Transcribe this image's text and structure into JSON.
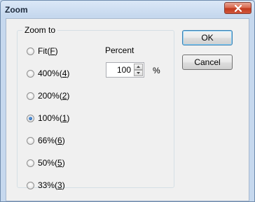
{
  "window": {
    "title": "Zoom"
  },
  "group": {
    "label": "Zoom to"
  },
  "options": [
    {
      "text": "Fit(",
      "key": "F",
      "end": ")",
      "checked": false
    },
    {
      "text": "400%(",
      "key": "4",
      "end": ")",
      "checked": false
    },
    {
      "text": "200%(",
      "key": "2",
      "end": ")",
      "checked": false
    },
    {
      "text": "100%(",
      "key": "1",
      "end": ")",
      "checked": true
    },
    {
      "text": "66%(",
      "key": "6",
      "end": ")",
      "checked": false
    },
    {
      "text": "50%(",
      "key": "5",
      "end": ")",
      "checked": false
    },
    {
      "text": "33%(",
      "key": "3",
      "end": ")",
      "checked": false
    }
  ],
  "percent": {
    "label": "Percent",
    "value": "100",
    "unit": "%"
  },
  "buttons": {
    "ok": "OK",
    "cancel": "Cancel"
  },
  "colors": {
    "close_button": "#c94a32",
    "dialog_background": "#f0f0f0",
    "window_frame": "#c6d8ee"
  }
}
